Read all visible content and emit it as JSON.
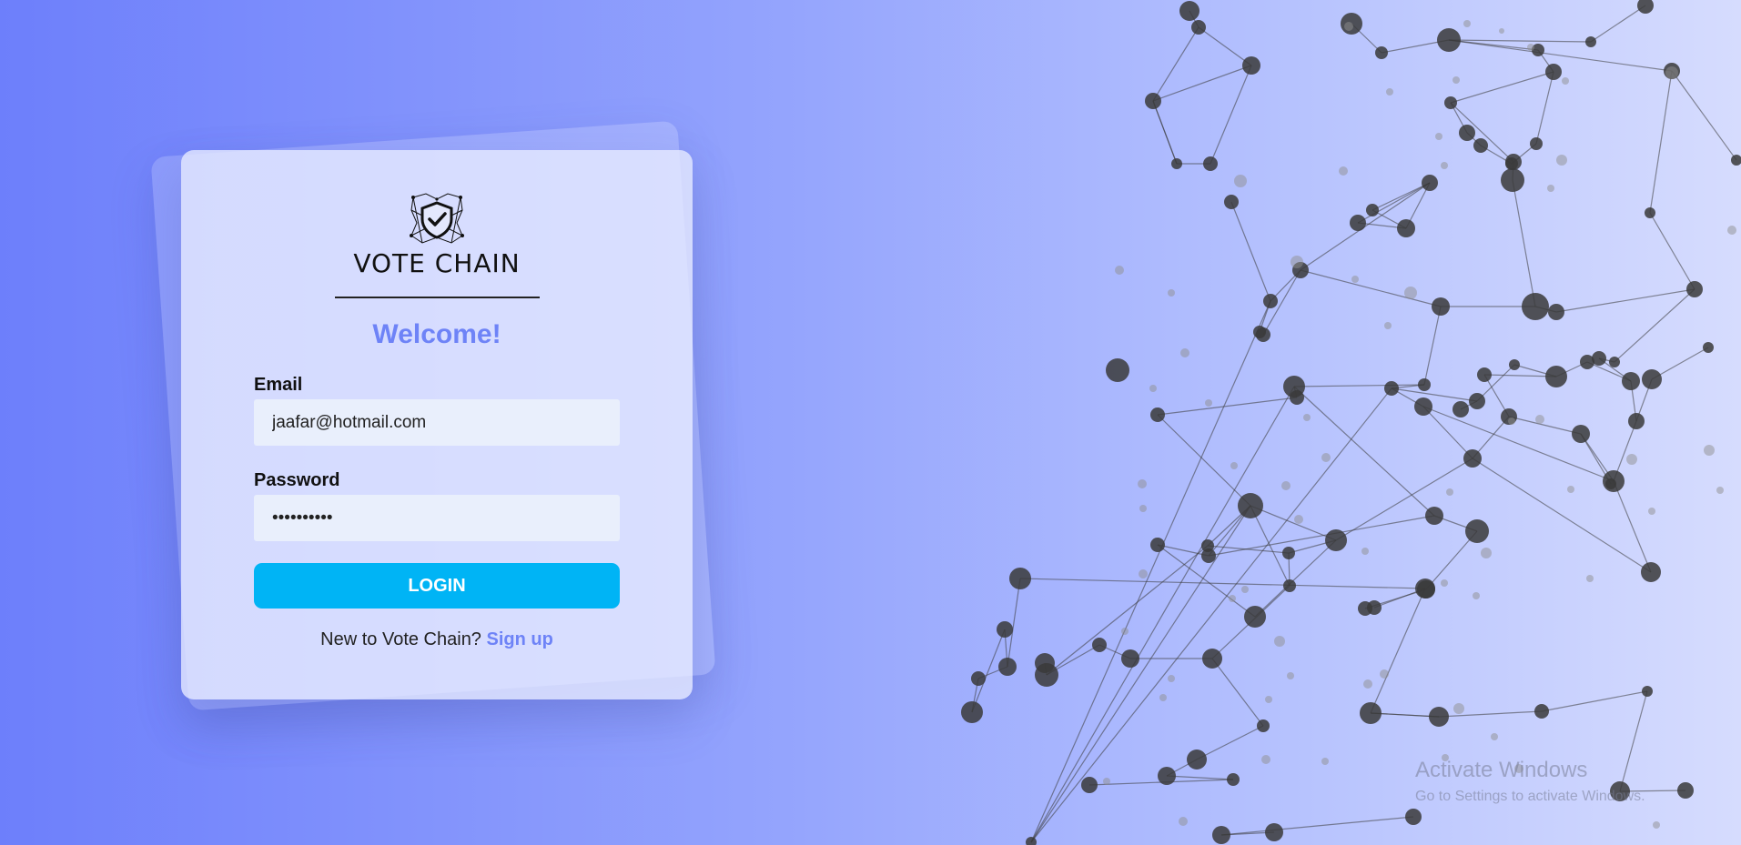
{
  "brand": {
    "name": "VOTE CHAIN",
    "logo_icon": "shield-check-icon"
  },
  "login_form": {
    "heading": "Welcome!",
    "email_label": "Email",
    "email_value": "jaafar@hotmail.com",
    "password_label": "Password",
    "password_value": "••••••••••",
    "login_label": "LOGIN",
    "signup_prompt": "New to Vote Chain?",
    "signup_link": "Sign up"
  },
  "background": {
    "decoration": "network-graph",
    "gradient_colors": [
      "#6d7ffb",
      "#94a4fd",
      "#b7c3fe",
      "#d6dcfe"
    ],
    "node_color": "#3a3a3a"
  },
  "watermark": {
    "title": "Activate Windows",
    "subtitle": "Go to Settings to activate Windows."
  },
  "colors": {
    "accent": "#6e83f7",
    "button": "#00b4f5",
    "input_bg": "#e9effc"
  }
}
